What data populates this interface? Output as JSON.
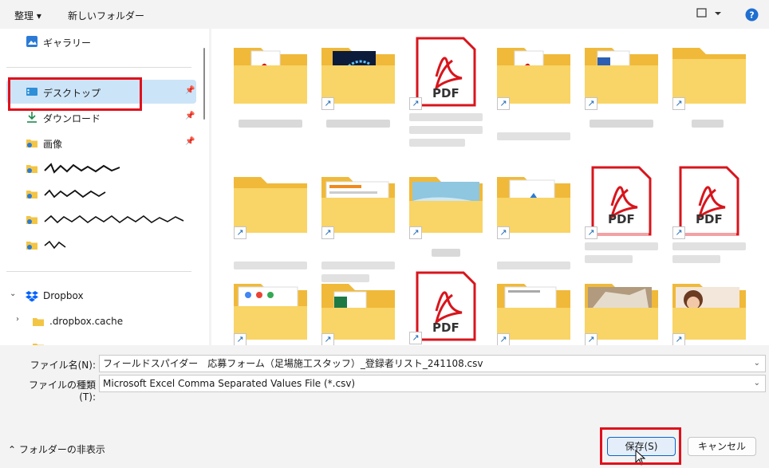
{
  "toolbar": {
    "organize_label": "整理 ▾",
    "new_folder_label": "新しいフォルダー",
    "view_icon": "layout-icon",
    "help_icon": "help-icon"
  },
  "sidebar": {
    "items": [
      {
        "label": "ギャラリー",
        "icon": "gallery-icon"
      },
      {
        "label": "デスクトップ",
        "icon": "desktop-icon",
        "selected": true,
        "pinned": true
      },
      {
        "label": "ダウンロード",
        "icon": "download-icon",
        "pinned": true
      },
      {
        "label": "画像",
        "icon": "pictures-icon",
        "pinned": true
      },
      {
        "label": "",
        "icon": "folder-icon"
      },
      {
        "label": "",
        "icon": "folder-icon"
      },
      {
        "label": "",
        "icon": "folder-icon"
      },
      {
        "label": "",
        "icon": "folder-icon"
      },
      {
        "label": "Dropbox",
        "icon": "dropbox-icon"
      },
      {
        "label": ".dropbox.cache",
        "icon": "folder-icon"
      }
    ]
  },
  "file_grid": {
    "pdf_label": "PDF"
  },
  "form": {
    "filename_label": "ファイル名(N):",
    "filename_value": "フィールドスパイダー　応募フォーム（足場施工スタッフ）_登録者リスト_241108.csv",
    "filetype_label": "ファイルの種類(T):",
    "filetype_value": "Microsoft Excel Comma Separated Values File (*.csv)"
  },
  "footer": {
    "hide_folders_label": "フォルダーの非表示",
    "save_label": "保存(S)",
    "cancel_label": "キャンセル"
  },
  "colors": {
    "accent": "#0a64c4",
    "highlight": "#e0101c",
    "selection": "#cce4f7",
    "folder": "#f7cd5a",
    "pdf_red": "#d8151c"
  }
}
